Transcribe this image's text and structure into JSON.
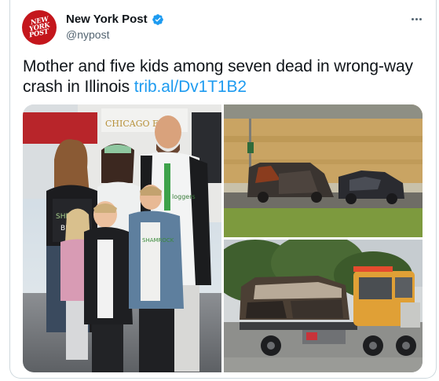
{
  "tweet": {
    "display_name": "New York Post",
    "handle": "@nypost",
    "avatar_logo_lines": [
      "NEW",
      "YORK",
      "POST"
    ],
    "text": "Mother and five kids among seven dead in wrong-way crash in Illinois ",
    "link_text": "trib.al/Dv1T1B2",
    "icons": {
      "verified": "verified-badge-icon",
      "more": "more-options-icon"
    },
    "colors": {
      "brand_red": "#c4161c",
      "link_blue": "#1d9bf0",
      "verified_blue": "#1d9bf0",
      "secondary_text": "#536471"
    }
  },
  "media": {
    "photos": [
      {
        "name": "family-photo"
      },
      {
        "name": "crash-scene-photo"
      },
      {
        "name": "tow-truck-photo"
      }
    ]
  }
}
